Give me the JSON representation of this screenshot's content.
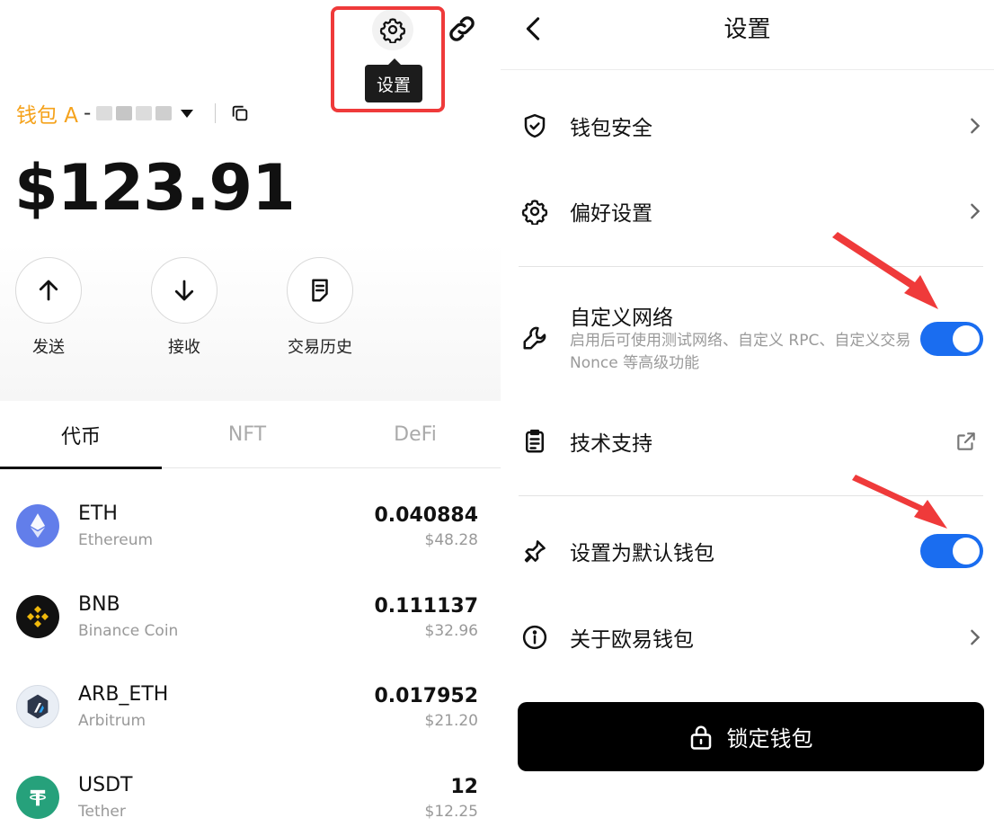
{
  "left": {
    "tooltip": "设置",
    "wallet": {
      "name": "钱包 A",
      "separator": "-"
    },
    "balance": "$123.91",
    "actions": [
      {
        "label": "发送",
        "icon": "arrow-up-icon"
      },
      {
        "label": "接收",
        "icon": "arrow-down-icon"
      },
      {
        "label": "交易历史",
        "icon": "history-icon"
      }
    ],
    "tabs": [
      "代币",
      "NFT",
      "DeFi"
    ],
    "active_tab": 0,
    "tokens": [
      {
        "symbol": "ETH",
        "name": "Ethereum",
        "amount": "0.040884",
        "usd": "$48.28",
        "color": "#627eea"
      },
      {
        "symbol": "BNB",
        "name": "Binance Coin",
        "amount": "0.111137",
        "usd": "$32.96",
        "color": "#f0b90b"
      },
      {
        "symbol": "ARB_ETH",
        "name": "Arbitrum",
        "amount": "0.017952",
        "usd": "$21.20",
        "color": "#2d374b"
      },
      {
        "symbol": "USDT",
        "name": "Tether",
        "amount": "12",
        "usd": "$12.25",
        "color": "#26a17b"
      }
    ]
  },
  "right": {
    "title": "设置",
    "items": {
      "security": "钱包安全",
      "preferences": "偏好设置",
      "custom_network": "自定义网络",
      "custom_network_desc": "启用后可使用测试网络、自定义 RPC、自定义交易 Nonce 等高级功能",
      "support": "技术支持",
      "default_wallet": "设置为默认钱包",
      "about": "关于欧易钱包"
    },
    "toggles": {
      "custom_network": true,
      "default_wallet": true
    },
    "lock_button": "锁定钱包"
  },
  "colors": {
    "accent": "#1a6df0",
    "wallet_name": "#f5a21b",
    "annotation": "#ef3a3a"
  }
}
